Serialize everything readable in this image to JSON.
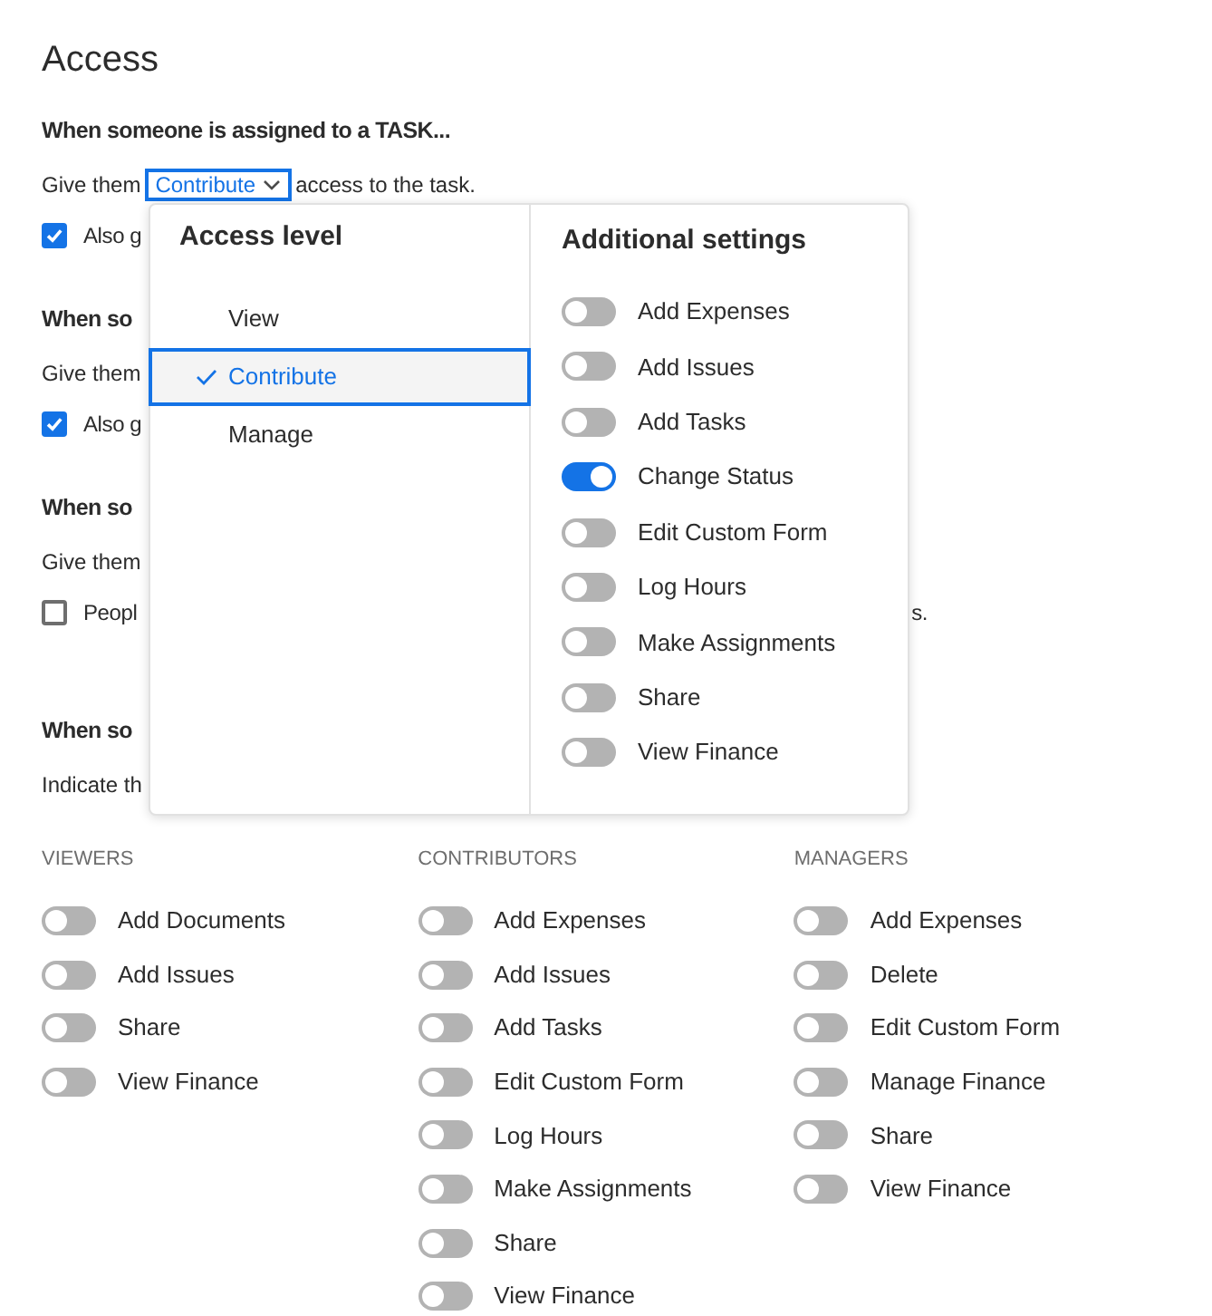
{
  "title": "Access",
  "sections": [
    {
      "heading": "When someone is assigned to a TASK...",
      "lines": [
        {
          "kind": "select",
          "before": "Give them",
          "value": "Contribute",
          "after": "access to the task."
        },
        {
          "kind": "checkbox",
          "checked": true,
          "label": "Also g"
        }
      ]
    },
    {
      "heading": "When so",
      "lines": [
        {
          "kind": "text",
          "text": "Give them"
        },
        {
          "kind": "checkbox",
          "checked": true,
          "label": "Also g"
        }
      ]
    },
    {
      "heading": "When so",
      "lines": [
        {
          "kind": "text",
          "text": "Give them"
        },
        {
          "kind": "checkbox",
          "checked": false,
          "label": "Peopl",
          "tail": "s."
        }
      ]
    },
    {
      "heading": "When so",
      "lines": [
        {
          "kind": "text",
          "text": "Indicate th"
        }
      ]
    }
  ],
  "columns": [
    {
      "header": "VIEWERS",
      "toggles": [
        {
          "label": "Add Documents",
          "on": false
        },
        {
          "label": "Add Issues",
          "on": false
        },
        {
          "label": "Share",
          "on": false
        },
        {
          "label": "View Finance",
          "on": false
        }
      ]
    },
    {
      "header": "CONTRIBUTORS",
      "toggles": [
        {
          "label": "Add Expenses",
          "on": false
        },
        {
          "label": "Add Issues",
          "on": false
        },
        {
          "label": "Add Tasks",
          "on": false
        },
        {
          "label": "Edit Custom Form",
          "on": false
        },
        {
          "label": "Log Hours",
          "on": false
        },
        {
          "label": "Make Assignments",
          "on": false
        },
        {
          "label": "Share",
          "on": false
        },
        {
          "label": "View Finance",
          "on": false
        }
      ]
    },
    {
      "header": "MANAGERS",
      "toggles": [
        {
          "label": "Add Expenses",
          "on": false
        },
        {
          "label": "Delete",
          "on": false
        },
        {
          "label": "Edit Custom Form",
          "on": false
        },
        {
          "label": "Manage Finance",
          "on": false
        },
        {
          "label": "Share",
          "on": false
        },
        {
          "label": "View Finance",
          "on": false
        }
      ]
    }
  ],
  "popover": {
    "access_level": {
      "title": "Access level",
      "options": [
        {
          "label": "View",
          "selected": false
        },
        {
          "label": "Contribute",
          "selected": true
        },
        {
          "label": "Manage",
          "selected": false
        }
      ]
    },
    "additional_settings": {
      "title": "Additional settings",
      "toggles": [
        {
          "label": "Add Expenses",
          "on": false
        },
        {
          "label": "Add Issues",
          "on": false
        },
        {
          "label": "Add Tasks",
          "on": false
        },
        {
          "label": "Change Status",
          "on": true
        },
        {
          "label": "Edit Custom Form",
          "on": false
        },
        {
          "label": "Log Hours",
          "on": false
        },
        {
          "label": "Make Assignments",
          "on": false
        },
        {
          "label": "Share",
          "on": false
        },
        {
          "label": "View Finance",
          "on": false
        }
      ]
    }
  }
}
